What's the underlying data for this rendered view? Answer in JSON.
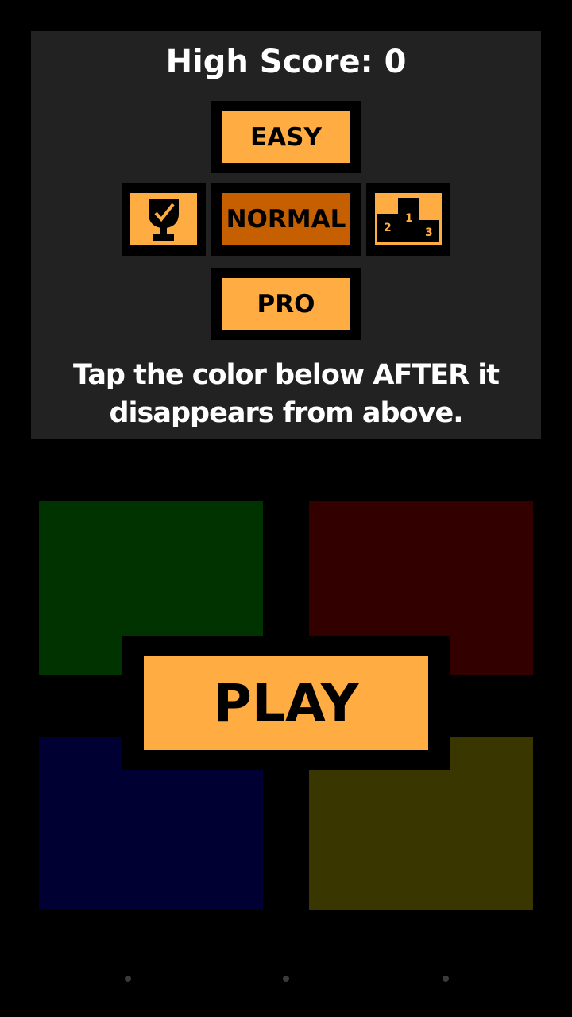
{
  "high_score": "High Score: 0",
  "difficulty": {
    "easy_label": "EASY",
    "normal_label": "NORMAL",
    "pro_label": "PRO",
    "selected": "NORMAL"
  },
  "icons": {
    "achievements": "trophy-icon",
    "leaderboard": "podium-icon",
    "podium_ranks": [
      "2",
      "1",
      "3"
    ]
  },
  "instructions": [
    "Tap the color below AFTER it",
    "disappears from above."
  ],
  "tiles": {
    "green": "#013300",
    "red": "#330000",
    "blue": "#000033",
    "yellow": "#3a3600"
  },
  "play_label": "PLAY",
  "colors": {
    "accent": "#ffad42",
    "selected": "#c55f00",
    "panel": "#222222"
  }
}
